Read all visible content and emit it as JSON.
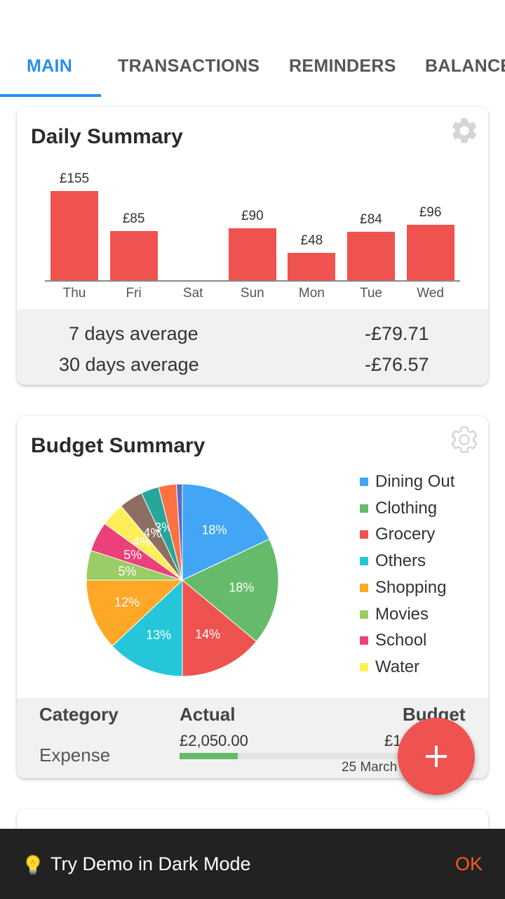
{
  "tabs": [
    "MAIN",
    "TRANSACTIONS",
    "REMINDERS",
    "BALANCE"
  ],
  "daily_summary": {
    "title": "Daily Summary",
    "settings_icon": "gear-icon",
    "bars": [
      {
        "day": "Thu",
        "label": "£155",
        "value": 155
      },
      {
        "day": "Fri",
        "label": "£85",
        "value": 85
      },
      {
        "day": "Sat",
        "label": "",
        "value": 0
      },
      {
        "day": "Sun",
        "label": "£90",
        "value": 90
      },
      {
        "day": "Mon",
        "label": "£48",
        "value": 48
      },
      {
        "day": "Tue",
        "label": "£84",
        "value": 84
      },
      {
        "day": "Wed",
        "label": "£96",
        "value": 96
      }
    ],
    "averages": [
      {
        "label": "7 days average",
        "value": "-£79.71"
      },
      {
        "label": "30 days average",
        "value": "-£76.57"
      }
    ],
    "bar_color": "#ef5350"
  },
  "budget_summary": {
    "title": "Budget Summary",
    "settings_icon": "gear-icon",
    "slices": [
      {
        "name": "Dining Out",
        "value": 18,
        "label": "18%",
        "color": "#42a5f5"
      },
      {
        "name": "Clothing",
        "value": 18,
        "label": "18%",
        "color": "#66bb6a"
      },
      {
        "name": "Grocery",
        "value": 14,
        "label": "14%",
        "color": "#ef5350"
      },
      {
        "name": "Others",
        "value": 13,
        "label": "13%",
        "color": "#26c6da"
      },
      {
        "name": "Shopping",
        "value": 12,
        "label": "12%",
        "color": "#ffa726"
      },
      {
        "name": "Movies",
        "value": 5,
        "label": "5%",
        "color": "#9ccc65"
      },
      {
        "name": "School",
        "value": 5,
        "label": "5%",
        "color": "#ec407a"
      },
      {
        "name": "Water",
        "value": 4,
        "label": "4%",
        "color": "#ffee58"
      },
      {
        "name": "",
        "value": 4,
        "label": "4%",
        "color": "#8d6e63"
      },
      {
        "name": "",
        "value": 3,
        "label": "3%",
        "color": "#26a69a"
      },
      {
        "name": "",
        "value": 3,
        "label": "",
        "color": "#ff7043"
      },
      {
        "name": "",
        "value": 1,
        "label": "",
        "color": "#5c6bc0"
      }
    ],
    "legend": [
      "Dining Out",
      "Clothing",
      "Grocery",
      "Others",
      "Shopping",
      "Movies",
      "School",
      "Water"
    ],
    "table": {
      "headers": {
        "category": "Category",
        "actual": "Actual",
        "budget": "Budget"
      },
      "row": {
        "category": "Expense",
        "actual": "£2,050.00",
        "budget_partial": "£1",
        "progress": 0.26,
        "date_partial": "25 March"
      }
    }
  },
  "fab": {
    "label": "+"
  },
  "snackbar": {
    "icon": "lightbulb-icon",
    "text": "Try Demo in Dark Mode",
    "action": "OK"
  }
}
